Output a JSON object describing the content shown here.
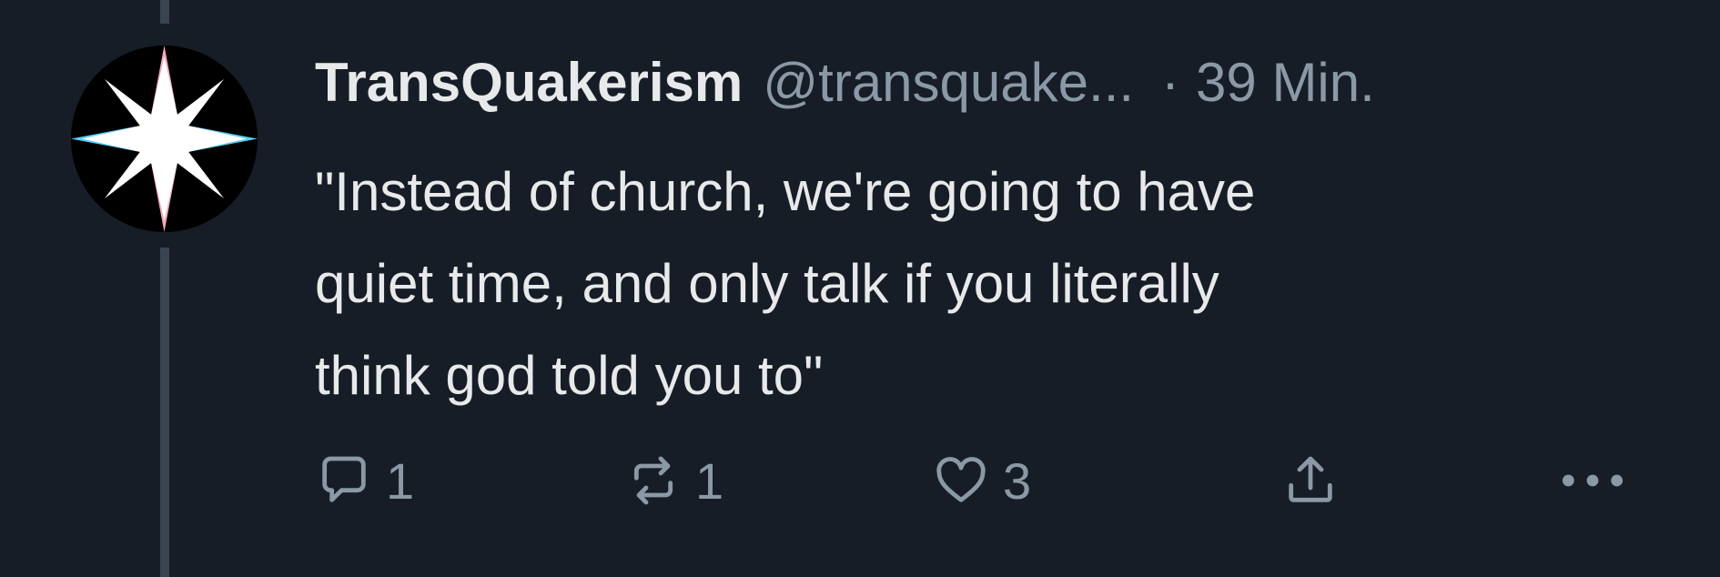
{
  "tweet": {
    "display_name": "TransQuakerism",
    "handle": "@transquake...",
    "separator": "·",
    "time": "39 Min.",
    "text_lines": [
      "\"Instead of church, we're going to have",
      "quiet time, and only talk if you literally",
      "think god told you to\""
    ]
  },
  "avatar": {
    "icon": "compass-star-icon",
    "colors": {
      "background": "#000000",
      "pink": "#f4a7b9",
      "blue": "#5bcefa",
      "white": "#ffffff"
    }
  },
  "actions": {
    "reply": {
      "icon": "reply-icon",
      "count": "1"
    },
    "retweet": {
      "icon": "retweet-icon",
      "count": "1"
    },
    "like": {
      "icon": "heart-icon",
      "count": "3"
    },
    "share": {
      "icon": "share-icon"
    },
    "more": {
      "icon": "more-icon"
    }
  },
  "colors": {
    "background": "#161d27",
    "text": "#e7e9ea",
    "muted": "#8b98a5",
    "thread_line": "#3a4450"
  }
}
